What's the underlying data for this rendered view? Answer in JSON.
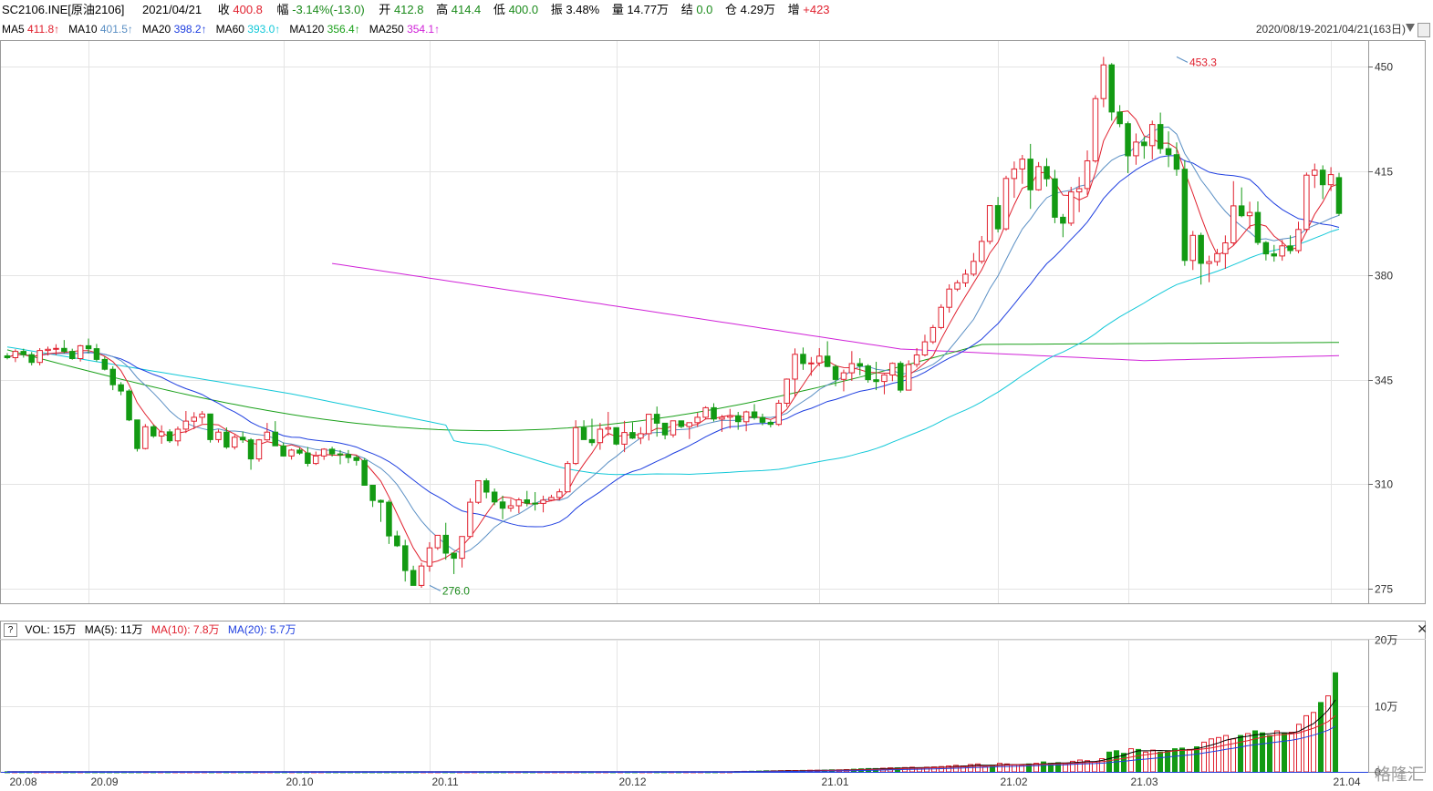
{
  "header": {
    "symbol": "SC2106.INE[原油2106]",
    "date": "2021/04/21",
    "close_label": "收",
    "close": "400.8",
    "change_label": "幅",
    "change": "-3.14%(-13.0)",
    "open_label": "开",
    "open": "412.8",
    "high_label": "高",
    "high": "414.4",
    "low_label": "低",
    "low": "400.0",
    "amp_label": "振",
    "amp": "3.48%",
    "vol_label": "量",
    "vol": "14.77万",
    "settle_label": "结",
    "settle": "0.0",
    "oi_label": "仓",
    "oi": "4.29万",
    "inc_label": "增",
    "inc": "+423"
  },
  "ma_legend": [
    {
      "label": "MA5",
      "value": "411.8↑",
      "color": "#e0202e"
    },
    {
      "label": "MA10",
      "value": "401.5↑",
      "color": "#5a8fc4"
    },
    {
      "label": "MA20",
      "value": "398.2↑",
      "color": "#1f3fe0"
    },
    {
      "label": "MA60",
      "value": "393.0↑",
      "color": "#12c8d8"
    },
    {
      "label": "MA120",
      "value": "356.4↑",
      "color": "#1aa01a"
    },
    {
      "label": "MA250",
      "value": "354.1↑",
      "color": "#d022d8"
    }
  ],
  "range_text": "2020/08/19-2021/04/21(163日)",
  "vol_legend": {
    "q": "?",
    "vol": "VOL: 15万",
    "ma5": "MA(5): 11万",
    "ma10": "MA(10): 7.8万",
    "ma20": "MA(20): 5.7万",
    "ma10_color": "#e0202e",
    "ma20_color": "#1f3fe0"
  },
  "logo_text": "格隆汇",
  "chart_data": {
    "type": "candlestick",
    "ylim": [
      270,
      458
    ],
    "y_ticks": [
      275,
      310,
      345,
      380,
      415,
      450
    ],
    "vol_ticks": [
      "0",
      "10万",
      "20万"
    ],
    "vol_ylim": [
      0,
      20
    ],
    "x_labels": [
      {
        "label": "20.08",
        "i": 0
      },
      {
        "label": "20.09",
        "i": 10
      },
      {
        "label": "20.10",
        "i": 34
      },
      {
        "label": "20.11",
        "i": 52
      },
      {
        "label": "20.12",
        "i": 75
      },
      {
        "label": "21.01",
        "i": 100
      },
      {
        "label": "21.02",
        "i": 122
      },
      {
        "label": "21.03",
        "i": 138
      },
      {
        "label": "21.04",
        "i": 163
      }
    ],
    "annotations": [
      {
        "text": "453.3",
        "i": 144,
        "value": 453.3,
        "color": "#e0202e"
      },
      {
        "text": "276.0",
        "i": 52,
        "value": 276.0,
        "color": "#1a8a1a"
      }
    ],
    "ohlc": [
      [
        353.0,
        353.9,
        351.8,
        352.4
      ],
      [
        352.4,
        355.2,
        350.9,
        354.5
      ],
      [
        354.5,
        355.4,
        352.4,
        353.4
      ],
      [
        353.4,
        354.3,
        349.8,
        350.8
      ],
      [
        350.8,
        355.6,
        349.8,
        354.8
      ],
      [
        354.8,
        356.1,
        353.1,
        355.2
      ],
      [
        355.2,
        356.9,
        353.2,
        355.5
      ],
      [
        355.5,
        358.3,
        353.8,
        354.5
      ],
      [
        354.5,
        355.4,
        351.7,
        352.1
      ],
      [
        352.1,
        356.7,
        351.1,
        356.4
      ],
      [
        356.4,
        358.8,
        353.8,
        355.4
      ],
      [
        355.4,
        357.0,
        351.1,
        351.8
      ],
      [
        351.8,
        352.7,
        348.1,
        348.5
      ],
      [
        348.5,
        349.5,
        341.5,
        343.3
      ],
      [
        343.3,
        344.2,
        339.8,
        341.2
      ],
      [
        341.2,
        341.8,
        331.1,
        331.5
      ],
      [
        331.5,
        331.6,
        320.9,
        321.9
      ],
      [
        321.9,
        330.1,
        321.6,
        329.2
      ],
      [
        329.2,
        329.9,
        325.5,
        326.1
      ],
      [
        326.1,
        329.7,
        323.5,
        327.5
      ],
      [
        327.5,
        328.4,
        323.8,
        324.5
      ],
      [
        324.5,
        329.3,
        322.8,
        328.4
      ],
      [
        328.4,
        334.5,
        327.1,
        331.1
      ],
      [
        331.1,
        334.1,
        328.4,
        332.4
      ],
      [
        332.4,
        334.5,
        330.3,
        333.5
      ],
      [
        333.5,
        333.6,
        323.9,
        324.9
      ],
      [
        324.9,
        328.3,
        323.9,
        327.4
      ],
      [
        327.4,
        329.0,
        321.8,
        322.4
      ],
      [
        322.4,
        326.5,
        321.6,
        325.7
      ],
      [
        325.7,
        327.6,
        323.8,
        324.8
      ],
      [
        324.8,
        325.4,
        314.8,
        318.4
      ],
      [
        318.4,
        325.1,
        317.5,
        324.8
      ],
      [
        324.8,
        330.5,
        324.5,
        327.4
      ],
      [
        327.4,
        331.1,
        325.1,
        322.8
      ],
      [
        322.8,
        323.9,
        319.2,
        319.4
      ],
      [
        319.4,
        321.8,
        318.2,
        321.4
      ],
      [
        321.4,
        322.2,
        319.8,
        320.4
      ],
      [
        320.4,
        322.4,
        315.9,
        316.9
      ],
      [
        316.9,
        320.9,
        316.4,
        319.4
      ],
      [
        319.4,
        322.0,
        318.1,
        321.7
      ],
      [
        321.7,
        322.5,
        319.2,
        320.1
      ],
      [
        320.1,
        321.4,
        316.6,
        319.9
      ],
      [
        319.9,
        321.4,
        317.0,
        318.9
      ],
      [
        318.9,
        319.5,
        316.2,
        317.9
      ],
      [
        317.9,
        318.7,
        309.5,
        309.6
      ],
      [
        309.6,
        309.7,
        302.3,
        304.5
      ],
      [
        304.5,
        304.8,
        297.3,
        303.9
      ],
      [
        303.9,
        304.6,
        289.9,
        292.6
      ],
      [
        292.6,
        294.3,
        288.9,
        289.3
      ],
      [
        289.3,
        291.3,
        277.3,
        281.0
      ],
      [
        281.0,
        282.6,
        276.0,
        276.0
      ],
      [
        276.0,
        283.6,
        275.2,
        282.5
      ],
      [
        282.5,
        290.5,
        280.6,
        288.6
      ],
      [
        288.6,
        292.8,
        287.9,
        292.8
      ],
      [
        292.8,
        297.0,
        284.6,
        286.8
      ],
      [
        286.8,
        286.9,
        279.8,
        285.1
      ],
      [
        285.1,
        289.5,
        282.0,
        292.4
      ],
      [
        292.4,
        305.2,
        291.9,
        303.9
      ],
      [
        303.9,
        307.6,
        303.3,
        311.1
      ],
      [
        311.1,
        311.9,
        305.2,
        307.3
      ],
      [
        307.3,
        308.5,
        302.9,
        304.0
      ],
      [
        304.0,
        306.1,
        298.2,
        301.9
      ],
      [
        301.9,
        305.0,
        300.7,
        302.7
      ],
      [
        302.7,
        305.4,
        300.2,
        304.7
      ],
      [
        304.7,
        307.7,
        302.5,
        303.6
      ],
      [
        303.6,
        307.3,
        301.1,
        303.5
      ],
      [
        303.5,
        306.1,
        300.5,
        304.6
      ],
      [
        304.6,
        306.4,
        304.2,
        305.5
      ],
      [
        305.5,
        308.4,
        304.6,
        307.4
      ],
      [
        307.4,
        317.7,
        307.3,
        316.9
      ],
      [
        316.9,
        331.4,
        316.4,
        328.9
      ],
      [
        328.9,
        331.4,
        326.0,
        324.9
      ],
      [
        324.9,
        331.9,
        322.8,
        323.9
      ],
      [
        323.9,
        330.5,
        321.5,
        328.4
      ],
      [
        328.4,
        334.2,
        326.2,
        328.9
      ],
      [
        328.9,
        329.0,
        323.0,
        323.4
      ],
      [
        323.4,
        331.2,
        320.7,
        327.3
      ],
      [
        327.3,
        330.7,
        325.1,
        325.4
      ],
      [
        325.4,
        329.1,
        323.4,
        326.9
      ],
      [
        326.9,
        331.4,
        324.6,
        333.4
      ],
      [
        333.4,
        336.0,
        325.9,
        330.4
      ],
      [
        330.4,
        330.5,
        325.0,
        326.5
      ],
      [
        326.5,
        331.2,
        325.6,
        331.2
      ],
      [
        331.2,
        331.3,
        328.7,
        329.3
      ],
      [
        329.3,
        330.6,
        325.1,
        330.6
      ],
      [
        330.6,
        333.9,
        329.1,
        332.4
      ],
      [
        332.4,
        336.1,
        331.9,
        335.6
      ],
      [
        335.6,
        337.1,
        331.0,
        331.8
      ],
      [
        331.8,
        333.2,
        327.5,
        332.4
      ],
      [
        332.4,
        335.2,
        328.6,
        332.9
      ],
      [
        332.9,
        334.2,
        328.2,
        330.9
      ],
      [
        330.9,
        334.6,
        327.7,
        334.2
      ],
      [
        334.2,
        336.8,
        331.6,
        332.3
      ],
      [
        332.3,
        333.6,
        329.7,
        330.7
      ],
      [
        330.7,
        331.4,
        329.0,
        330.0
      ],
      [
        330.0,
        338.2,
        329.5,
        337.1
      ],
      [
        337.1,
        345.4,
        335.8,
        345.2
      ],
      [
        345.2,
        355.5,
        339.2,
        353.5
      ],
      [
        353.5,
        355.8,
        348.3,
        350.4
      ],
      [
        350.4,
        352.6,
        346.3,
        350.6
      ],
      [
        350.6,
        355.6,
        349.5,
        352.9
      ],
      [
        352.9,
        357.9,
        349.2,
        349.4
      ],
      [
        349.4,
        350.1,
        342.8,
        345.1
      ],
      [
        345.1,
        348.4,
        341.1,
        347.3
      ],
      [
        347.3,
        354.6,
        344.6,
        350.4
      ],
      [
        350.4,
        352.2,
        346.5,
        349.6
      ],
      [
        349.6,
        350.2,
        344.0,
        345.0
      ],
      [
        345.0,
        351.0,
        341.5,
        344.4
      ],
      [
        344.4,
        346.9,
        340.1,
        346.6
      ],
      [
        346.6,
        350.8,
        344.5,
        350.5
      ],
      [
        350.5,
        351.2,
        340.7,
        341.5
      ],
      [
        341.5,
        351.5,
        341.4,
        350.1
      ],
      [
        350.1,
        355.6,
        349.1,
        353.3
      ],
      [
        353.3,
        360.1,
        352.8,
        357.7
      ],
      [
        357.7,
        363.4,
        357.0,
        362.5
      ],
      [
        362.5,
        370.3,
        361.9,
        369.3
      ],
      [
        369.3,
        377.0,
        367.5,
        375.4
      ],
      [
        375.4,
        378.4,
        374.7,
        377.5
      ],
      [
        377.5,
        382.0,
        376.1,
        380.4
      ],
      [
        380.4,
        387.5,
        379.7,
        384.7
      ],
      [
        384.7,
        393.2,
        383.9,
        391.4
      ],
      [
        391.4,
        403.5,
        390.4,
        403.4
      ],
      [
        403.4,
        406.3,
        394.4,
        395.6
      ],
      [
        395.6,
        413.4,
        395.0,
        412.5
      ],
      [
        412.5,
        418.2,
        406.0,
        415.7
      ],
      [
        415.7,
        420.4,
        410.7,
        419.0
      ],
      [
        419.0,
        424.1,
        402.3,
        408.7
      ],
      [
        408.7,
        418.0,
        408.4,
        416.5
      ],
      [
        416.5,
        419.3,
        409.8,
        412.4
      ],
      [
        412.4,
        415.4,
        397.5,
        399.5
      ],
      [
        399.5,
        400.6,
        392.8,
        397.5
      ],
      [
        397.5,
        409.7,
        396.6,
        408.0
      ],
      [
        408.0,
        413.0,
        401.2,
        409.1
      ],
      [
        409.1,
        421.9,
        407.0,
        418.4
      ],
      [
        418.4,
        440.4,
        417.8,
        439.3
      ],
      [
        439.3,
        453.3,
        436.4,
        450.6
      ],
      [
        450.6,
        451.2,
        431.9,
        434.8
      ],
      [
        434.8,
        437.1,
        429.7,
        430.9
      ],
      [
        430.9,
        431.6,
        414.3,
        420.1
      ],
      [
        420.1,
        427.6,
        417.1,
        424.7
      ],
      [
        424.7,
        426.5,
        419.1,
        423.5
      ],
      [
        423.5,
        431.9,
        418.9,
        430.6
      ],
      [
        430.6,
        434.6,
        420.8,
        422.5
      ],
      [
        422.5,
        428.3,
        416.3,
        420.5
      ],
      [
        420.5,
        424.6,
        413.4,
        415.6
      ],
      [
        415.6,
        418.7,
        383.2,
        385.0
      ],
      [
        385.0,
        394.9,
        381.8,
        393.4
      ],
      [
        393.4,
        394.3,
        376.9,
        384.0
      ],
      [
        384.0,
        386.6,
        377.7,
        384.6
      ],
      [
        384.6,
        388.9,
        383.2,
        387.3
      ],
      [
        387.3,
        393.4,
        382.2,
        390.9
      ],
      [
        390.9,
        411.6,
        390.1,
        403.3
      ],
      [
        403.3,
        409.5,
        399.5,
        400.0
      ],
      [
        400.0,
        404.7,
        395.6,
        401.1
      ],
      [
        401.1,
        404.8,
        390.2,
        391.0
      ],
      [
        391.0,
        391.5,
        385.0,
        387.2
      ],
      [
        387.2,
        390.2,
        384.6,
        386.5
      ],
      [
        386.5,
        391.9,
        384.9,
        389.9
      ],
      [
        389.9,
        393.4,
        387.2,
        388.3
      ],
      [
        388.3,
        398.0,
        387.4,
        395.4
      ],
      [
        395.4,
        414.5,
        394.4,
        413.6
      ],
      [
        413.6,
        417.5,
        409.3,
        415.3
      ],
      [
        415.3,
        416.9,
        405.6,
        410.4
      ],
      [
        410.4,
        416.3,
        408.3,
        413.8
      ],
      [
        412.8,
        414.4,
        400.0,
        400.8
      ]
    ],
    "volume_wan": [
      0.01,
      0.01,
      0.01,
      0.01,
      0.01,
      0.01,
      0.01,
      0.01,
      0.01,
      0.01,
      0.01,
      0.01,
      0.01,
      0.01,
      0.01,
      0.01,
      0.01,
      0.01,
      0.01,
      0.01,
      0.01,
      0.01,
      0.01,
      0.01,
      0.01,
      0.01,
      0.01,
      0.01,
      0.01,
      0.01,
      0.01,
      0.01,
      0.01,
      0.01,
      0.01,
      0.01,
      0.01,
      0.01,
      0.01,
      0.01,
      0.01,
      0.01,
      0.01,
      0.01,
      0.01,
      0.01,
      0.01,
      0.01,
      0.01,
      0.01,
      0.01,
      0.01,
      0.01,
      0.01,
      0.01,
      0.01,
      0.01,
      0.01,
      0.01,
      0.01,
      0.01,
      0.01,
      0.01,
      0.01,
      0.01,
      0.01,
      0.01,
      0.01,
      0.01,
      0.01,
      0.01,
      0.01,
      0.01,
      0.01,
      0.01,
      0.01,
      0.01,
      0.01,
      0.01,
      0.01,
      0.01,
      0.01,
      0.01,
      0.02,
      0.02,
      0.02,
      0.02,
      0.02,
      0.02,
      0.02,
      0.02,
      0.02,
      0.02,
      0.02,
      0.02,
      0.02,
      0.02,
      0.02,
      0.02,
      0.02,
      0.05,
      0.08,
      0.1,
      0.12,
      0.15,
      0.15,
      0.18,
      0.2,
      0.2,
      0.22,
      0.25,
      0.25,
      0.25,
      0.3,
      0.3,
      0.35,
      0.4,
      0.45,
      0.5,
      0.5,
      0.55,
      0.6,
      0.6,
      0.65,
      0.7,
      0.6,
      0.7,
      0.75,
      0.8,
      0.9,
      1.0,
      0.9,
      1.1,
      1.2,
      0.8,
      1.0,
      1.3,
      1.2,
      1.1,
      1.0,
      1.2,
      1.3,
      1.5,
      1.3,
      1.4,
      1.2,
      1.6,
      1.8,
      1.7,
      1.5,
      2.0,
      3.0,
      3.2,
      2.8,
      3.5,
      3.4,
      3.0,
      3.3,
      3.0,
      3.2,
      3.5,
      3.6,
      3.4,
      3.8,
      4.5,
      5.0,
      5.2,
      5.5,
      5.0,
      5.5,
      5.8,
      6.2,
      5.9,
      5.5,
      6.2,
      5.8,
      6.0,
      7.2,
      8.5,
      9.0,
      10.5,
      11.5,
      15.0
    ]
  }
}
